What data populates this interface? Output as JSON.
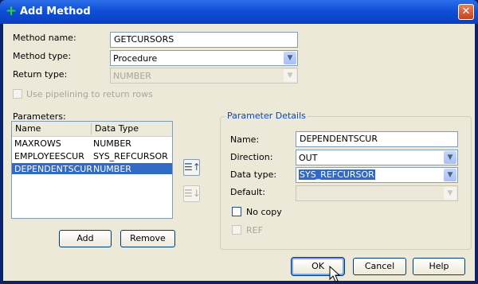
{
  "window": {
    "title": "Add Method"
  },
  "method": {
    "name_label": "Method name:",
    "name_value": "GETCURSORS",
    "type_label": "Method type:",
    "type_value": "Procedure",
    "return_label": "Return type:",
    "return_value": "NUMBER",
    "pipelining_label": "Use pipelining to return rows"
  },
  "parameters": {
    "label": "Parameters:",
    "columns": [
      "Name",
      "Data Type"
    ],
    "rows": [
      {
        "name": "MAXROWS",
        "type": "NUMBER"
      },
      {
        "name": "EMPLOYEESCUR",
        "type": "SYS_REFCURSOR"
      },
      {
        "name": "DEPENDENTSCUR",
        "type": "NUMBER"
      }
    ],
    "selected_index": 2,
    "add_label": "Add",
    "remove_label": "Remove"
  },
  "details": {
    "group_title": "Parameter Details",
    "name_label": "Name:",
    "name_value": "DEPENDENTSCUR",
    "direction_label": "Direction:",
    "direction_value": "OUT",
    "datatype_label": "Data type:",
    "datatype_value": "SYS_REFCURSOR",
    "default_label": "Default:",
    "default_value": "",
    "nocopy_label": "No copy",
    "ref_label": "REF"
  },
  "footer": {
    "ok_label": "OK",
    "cancel_label": "Cancel",
    "help_label": "Help"
  },
  "icons": {
    "title": "add-plus-icon",
    "close": "close-icon",
    "move_up": "move-up-icon",
    "move_down": "move-down-icon"
  },
  "colors": {
    "titlebar": "#0f4fd8",
    "selection": "#316ac5",
    "group_title": "#0046d5",
    "dialog_bg": "#ece9d8"
  }
}
